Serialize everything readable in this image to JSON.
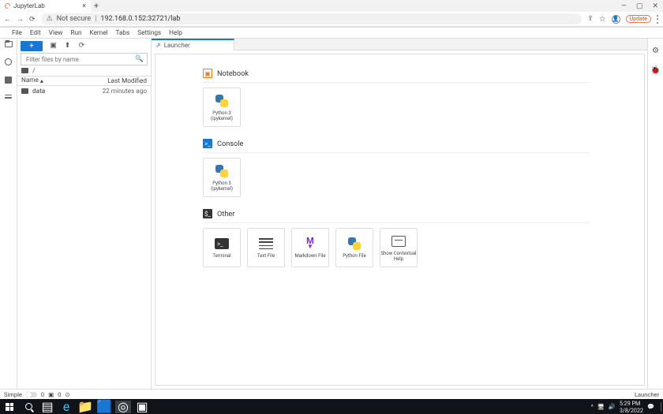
{
  "browser": {
    "tab_title": "JupyterLab",
    "address_prefix": "Not secure",
    "url": "192.168.0.152:32721/lab",
    "update_label": "Update"
  },
  "menubar": [
    "File",
    "Edit",
    "View",
    "Run",
    "Kernel",
    "Tabs",
    "Settings",
    "Help"
  ],
  "filepane": {
    "plus": "+",
    "filter_placeholder": "Filter files by name",
    "breadcrumb_slash": "/",
    "header_name": "Name",
    "header_modified": "Last Modified",
    "sort_indicator": "▴",
    "rows": [
      {
        "name": "data",
        "modified": "22 minutes ago"
      }
    ]
  },
  "main": {
    "tab_label": "Launcher",
    "sections": {
      "notebook": {
        "title": "Notebook",
        "cards": [
          {
            "label_line1": "Python 3",
            "label_line2": "(ipykernel)"
          }
        ]
      },
      "console": {
        "title": "Console",
        "icon_glyph": ">_",
        "cards": [
          {
            "label_line1": "Python 3",
            "label_line2": "(ipykernel)"
          }
        ]
      },
      "other": {
        "title": "Other",
        "icon_glyph": "$_",
        "cards": [
          {
            "label": "Terminal"
          },
          {
            "label": "Text File"
          },
          {
            "label": "Markdown File"
          },
          {
            "label": "Python File"
          },
          {
            "label": "Show Contextual Help"
          }
        ]
      }
    }
  },
  "status": {
    "simple": "Simple",
    "zero": "0",
    "launcher": "Launcher"
  },
  "taskbar": {
    "time": "5:29 PM",
    "date": "3/8/2022"
  },
  "icons": {
    "reload": "⟳",
    "upload": "⬆",
    "download": "⬇",
    "share": "⇪",
    "gear": "⚙",
    "left": "←",
    "right": "→",
    "up": "^",
    "bookmark_sq": "▣",
    "markdown_m": "M",
    "markdown_arw": "▼",
    "term_prompt": ">_",
    "wifi": "⌃",
    "sound": "🔊",
    "notify": "💬"
  }
}
